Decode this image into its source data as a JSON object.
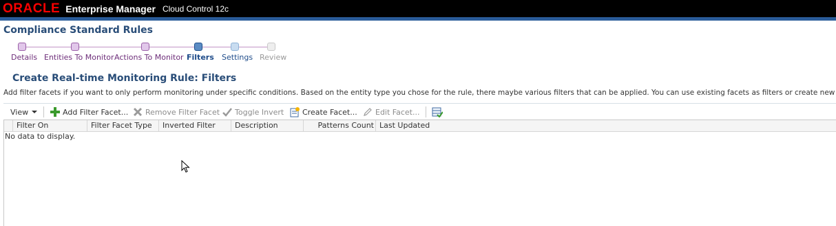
{
  "header": {
    "oracle_logo": "ORACLE",
    "product": "Enterprise Manager",
    "subtitle": "Cloud Control 12c"
  },
  "page": {
    "title": "Compliance Standard Rules"
  },
  "train": {
    "steps": [
      {
        "label": "Details",
        "state": "visited"
      },
      {
        "label": "Entities To Monitor",
        "state": "visited"
      },
      {
        "label": "Actions To Monitor",
        "state": "visited"
      },
      {
        "label": "Filters",
        "state": "current"
      },
      {
        "label": "Settings",
        "state": "next"
      },
      {
        "label": "Review",
        "state": "unvisited"
      }
    ]
  },
  "section": {
    "heading": "Create Real-time Monitoring Rule: Filters",
    "instructions": "Add filter facets if you want to only perform monitoring under specific conditions. Based on the entity type you chose for the rule, there maybe various filters that can be applied. You can use existing facets as filters or create new facets."
  },
  "toolbar": {
    "view": "View",
    "add": "Add Filter Facet...",
    "remove": "Remove Filter Facet",
    "toggle": "Toggle Invert",
    "create": "Create Facet...",
    "edit": "Edit Facet..."
  },
  "table": {
    "columns": [
      "Filter On",
      "Filter Facet Type",
      "Inverted Filter",
      "Description",
      "Patterns Count",
      "Last Updated"
    ],
    "empty_text": "No data to display."
  },
  "colors": {
    "brand_red": "#f80000",
    "title_blue": "#294d78",
    "visited_purple": "#6d2d79",
    "current_blue": "#1f4c8a"
  },
  "icons": [
    "add-icon",
    "remove-x-icon",
    "checkmark-icon",
    "create-facet-icon",
    "pencil-icon",
    "export-table-icon",
    "dropdown-arrow-icon",
    "mouse-cursor-icon"
  ]
}
